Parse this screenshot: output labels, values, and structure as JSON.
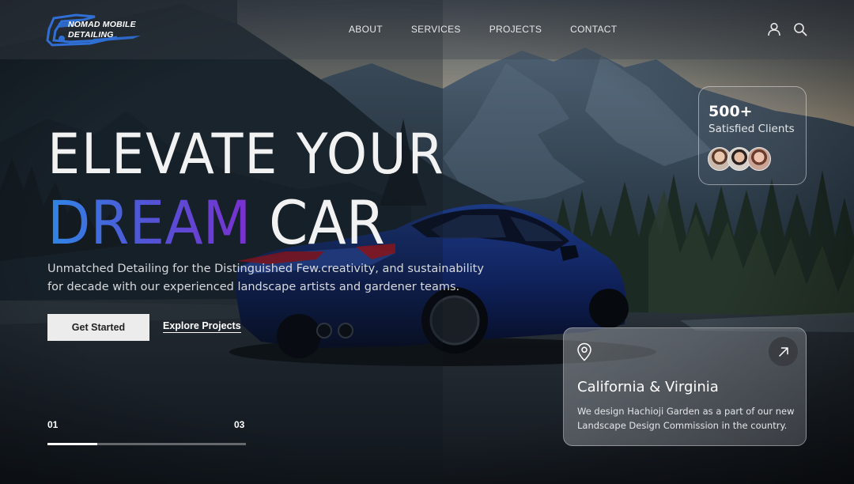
{
  "brand": {
    "line1": "NOMAD MOBILE",
    "line2": "DETAILING",
    "accent_color": "#2f6fd6"
  },
  "nav": {
    "items": [
      "ABOUT",
      "SERVICES",
      "PROJECTS",
      "CONTACT"
    ],
    "user_icon": "user-icon",
    "search_icon": "search-icon"
  },
  "hero": {
    "headline_line1": "ELEVATE YOUR",
    "headline_gradient_word": "DREAM",
    "headline_white_word": "CAR",
    "gradient_colors": [
      "#2f86e6",
      "#4f57d6",
      "#7a2fd0"
    ],
    "subtitle": "Unmatched Detailing for the Distinguished Few.creativity, and sustainability for decade with our experienced landscape artists and gardener teams.",
    "primary_button": "Get Started",
    "secondary_link": "Explore Projects"
  },
  "pager": {
    "current": "01",
    "total": "03",
    "progress": 0.25
  },
  "clients_card": {
    "count": "500+",
    "label": "Satisfied Clients",
    "avatar_count": 3
  },
  "location_card": {
    "title": "California & Virginia",
    "description": "We design Hachioji Garden as a part of our new Landscape Design Commission in the country.",
    "pin_icon": "location-pin-icon",
    "arrow_icon": "arrow-up-right-icon"
  }
}
